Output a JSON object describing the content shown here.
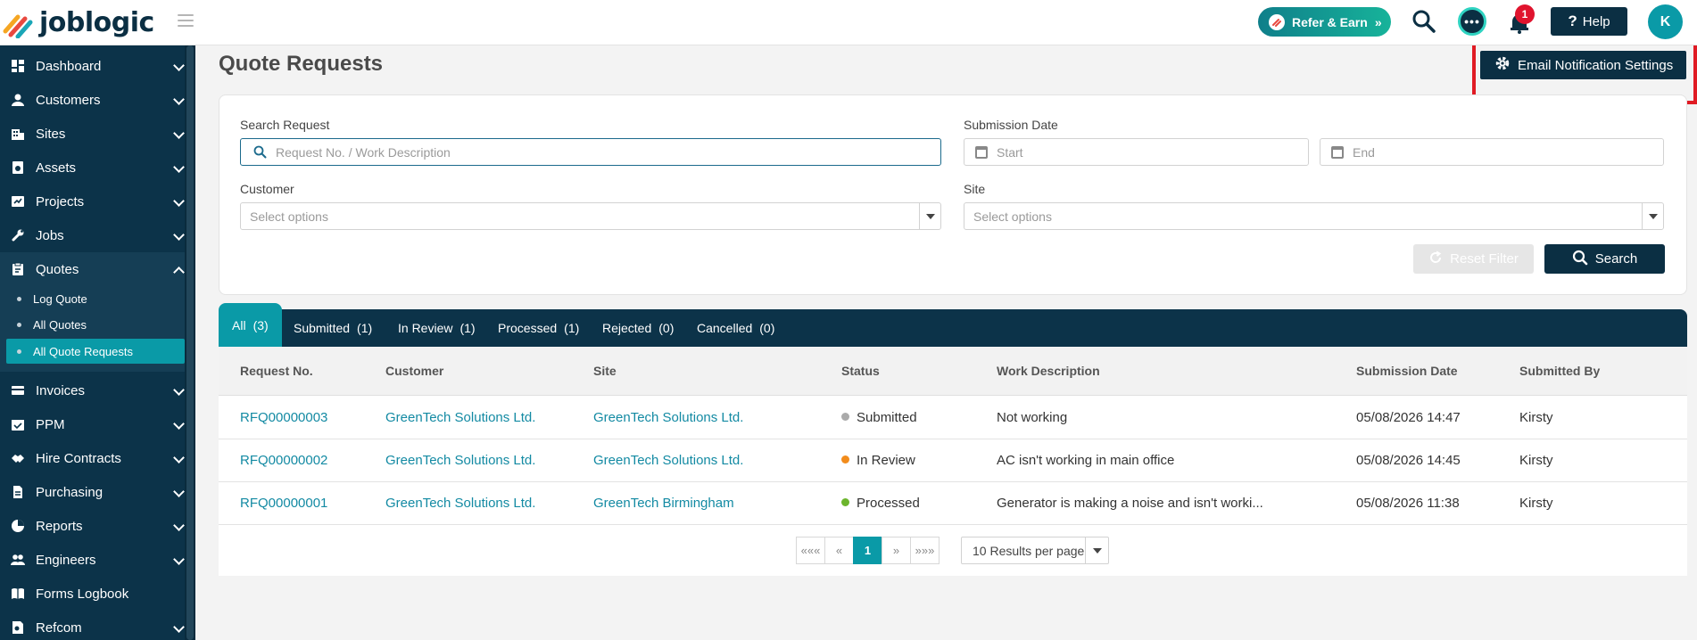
{
  "brand": {
    "name": "joblogic"
  },
  "topbar": {
    "refer_label": "Refer & Earn",
    "chat_glyph": "•••",
    "notification_count": "1",
    "help_label": "Help",
    "avatar_initial": "K"
  },
  "sidebar": {
    "items": [
      {
        "label": "Dashboard",
        "icon": "dashboard-icon"
      },
      {
        "label": "Customers",
        "icon": "user-icon"
      },
      {
        "label": "Sites",
        "icon": "building-icon"
      },
      {
        "label": "Assets",
        "icon": "asset-icon"
      },
      {
        "label": "Projects",
        "icon": "projects-icon"
      },
      {
        "label": "Jobs",
        "icon": "wrench-icon"
      },
      {
        "label": "Quotes",
        "icon": "clipboard-icon"
      },
      {
        "label": "Invoices",
        "icon": "invoice-icon"
      },
      {
        "label": "PPM",
        "icon": "calendar-icon"
      },
      {
        "label": "Hire Contracts",
        "icon": "handshake-icon"
      },
      {
        "label": "Purchasing",
        "icon": "document-icon"
      },
      {
        "label": "Reports",
        "icon": "pie-chart-icon"
      },
      {
        "label": "Engineers",
        "icon": "users-icon"
      },
      {
        "label": "Forms Logbook",
        "icon": "book-icon"
      },
      {
        "label": "Refcom",
        "icon": "refcom-icon"
      }
    ],
    "quotes_sub": [
      {
        "label": "Log Quote"
      },
      {
        "label": "All Quotes"
      },
      {
        "label": "All Quote Requests"
      }
    ]
  },
  "page": {
    "title": "Quote Requests",
    "email_settings_label": "Email Notification Settings"
  },
  "filters": {
    "search_label": "Search Request",
    "search_placeholder": "Request No. / Work Description",
    "date_label": "Submission Date",
    "start_placeholder": "Start",
    "end_placeholder": "End",
    "customer_label": "Customer",
    "customer_placeholder": "Select options",
    "site_label": "Site",
    "site_placeholder": "Select options",
    "reset_label": "Reset Filter",
    "search_button": "Search"
  },
  "tabs": [
    {
      "label": "All",
      "count": "(3)"
    },
    {
      "label": "Submitted",
      "count": "(1)"
    },
    {
      "label": "In Review",
      "count": "(1)"
    },
    {
      "label": "Processed",
      "count": "(1)"
    },
    {
      "label": "Rejected",
      "count": "(0)"
    },
    {
      "label": "Cancelled",
      "count": "(0)"
    }
  ],
  "table": {
    "columns": [
      "Request No.",
      "Customer",
      "Site",
      "Status",
      "Work Description",
      "Submission Date",
      "Submitted By"
    ],
    "rows": [
      {
        "request_no": "RFQ00000003",
        "customer": "GreenTech Solutions Ltd.",
        "site": "GreenTech Solutions Ltd.",
        "status": "Submitted",
        "status_color": "#aaaaaa",
        "work": "Not working",
        "date": "05/08/2026 14:47",
        "by": "Kirsty"
      },
      {
        "request_no": "RFQ00000002",
        "customer": "GreenTech Solutions Ltd.",
        "site": "GreenTech Solutions Ltd.",
        "status": "In Review",
        "status_color": "#f28c1c",
        "work": "AC isn't working in main office",
        "date": "05/08/2026 14:45",
        "by": "Kirsty"
      },
      {
        "request_no": "RFQ00000001",
        "customer": "GreenTech Solutions Ltd.",
        "site": "GreenTech Birmingham",
        "status": "Processed",
        "status_color": "#6cb52d",
        "work": "Generator is making a noise and isn't worki...",
        "date": "05/08/2026 11:38",
        "by": "Kirsty"
      }
    ]
  },
  "pagination": {
    "first": "«««",
    "prev": "«",
    "current": "1",
    "next": "»",
    "last": "»»»",
    "per_page": "10 Results per page"
  },
  "colors": {
    "primary_dark": "#0b2f43",
    "accent": "#0a9aa7",
    "highlight": "#e01b24"
  }
}
